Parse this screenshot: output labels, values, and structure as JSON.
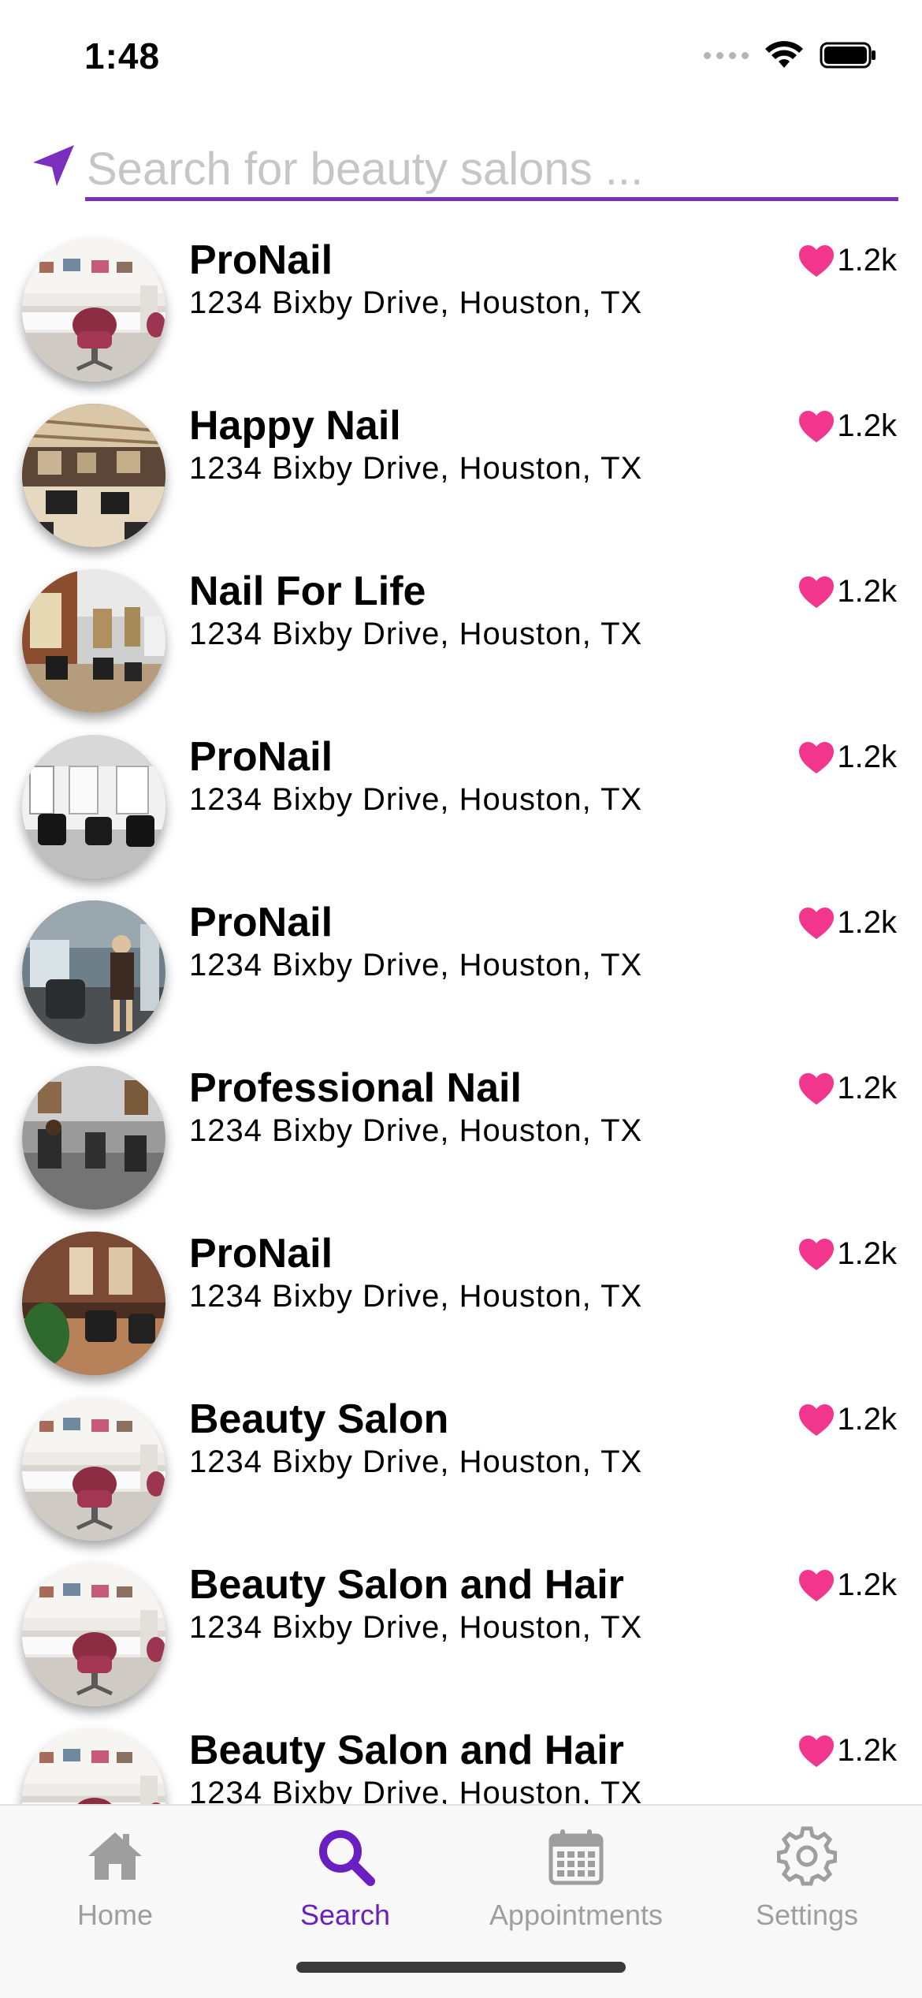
{
  "status_bar": {
    "time": "1:48"
  },
  "search": {
    "placeholder": "Search for beauty salons ...",
    "value": "",
    "icon": "location-arrow-icon",
    "accent_color": "#7b2fbe"
  },
  "salons": [
    {
      "name": "ProNail",
      "address": "1234 Bixby Drive, Houston, TX",
      "likes": "1.2k",
      "image": "white-salon-pink-chair"
    },
    {
      "name": "Happy Nail",
      "address": "1234 Bixby Drive, Houston, TX",
      "likes": "1.2k",
      "image": "warm-salon-interior"
    },
    {
      "name": "Nail For Life",
      "address": "1234 Bixby Drive, Houston, TX",
      "likes": "1.2k",
      "image": "salon-brick-mirrors"
    },
    {
      "name": "ProNail",
      "address": "1234 Bixby Drive, Houston, TX",
      "likes": "1.2k",
      "image": "bright-salon-black-chairs"
    },
    {
      "name": "ProNail",
      "address": "1234 Bixby Drive, Houston, TX",
      "likes": "1.2k",
      "image": "salon-stylist-at-station"
    },
    {
      "name": "Professional Nail",
      "address": "1234 Bixby Drive, Houston, TX",
      "likes": "1.2k",
      "image": "salon-wide-interior"
    },
    {
      "name": "ProNail",
      "address": "1234 Bixby Drive, Houston, TX",
      "likes": "1.2k",
      "image": "salon-brick-wall-plants"
    },
    {
      "name": "Beauty Salon",
      "address": "1234 Bixby Drive, Houston, TX",
      "likes": "1.2k",
      "image": "white-salon-pink-chair"
    },
    {
      "name": "Beauty Salon and Hair",
      "address": "1234 Bixby Drive, Houston, TX",
      "likes": "1.2k",
      "image": "white-salon-pink-chair"
    },
    {
      "name": "Beauty Salon and Hair",
      "address": "1234 Bixby Drive, Houston, TX",
      "likes": "1.2k",
      "image": "white-salon-pink-chair"
    }
  ],
  "like_color": "#f2368e",
  "tabs": [
    {
      "label": "Home",
      "icon": "home-icon",
      "active": false
    },
    {
      "label": "Search",
      "icon": "search-icon",
      "active": true
    },
    {
      "label": "Appointments",
      "icon": "calendar-icon",
      "active": false
    },
    {
      "label": "Settings",
      "icon": "gear-icon",
      "active": false
    }
  ],
  "tab_colors": {
    "active": "#6a1fc0",
    "inactive": "#9e9e9e"
  }
}
